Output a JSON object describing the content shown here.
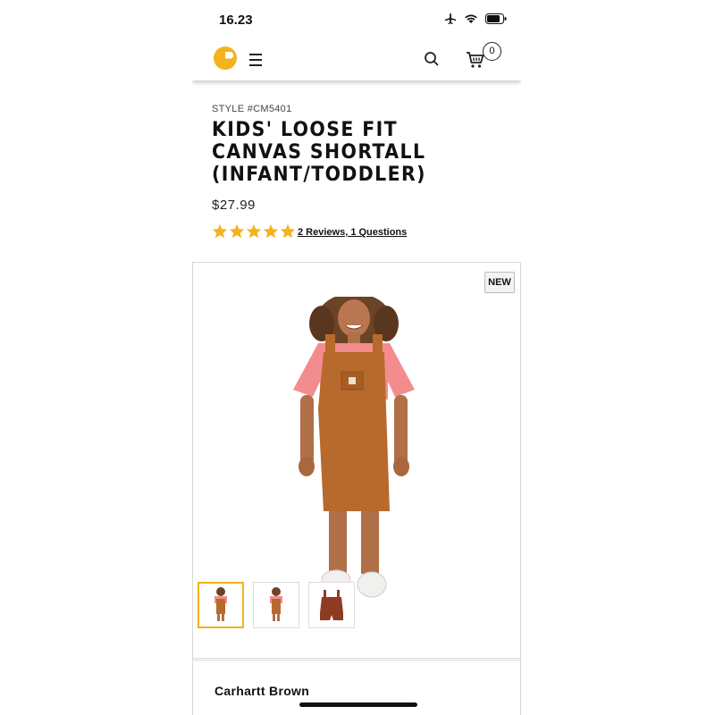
{
  "status_bar": {
    "time": "16.23"
  },
  "header": {
    "cart_count": "0"
  },
  "product": {
    "style_number": "STYLE #CM5401",
    "title": "KIDS' LOOSE FIT CANVAS SHORTALL (INFANT/TODDLER)",
    "price": "$27.99",
    "rating": 5,
    "reviews_link": "2 Reviews, 1 Questions",
    "badge": "NEW",
    "color_label": "Carhartt Brown"
  },
  "colors": {
    "accent": "#f2b31f",
    "shirt": "#f38c8f",
    "overall": "#b8692c",
    "overall_dark": "#8e3b22"
  },
  "icons": [
    "carhartt-logo-icon",
    "menu-icon",
    "search-icon",
    "cart-icon",
    "airplane-icon",
    "wifi-icon",
    "battery-icon",
    "star-icon"
  ]
}
